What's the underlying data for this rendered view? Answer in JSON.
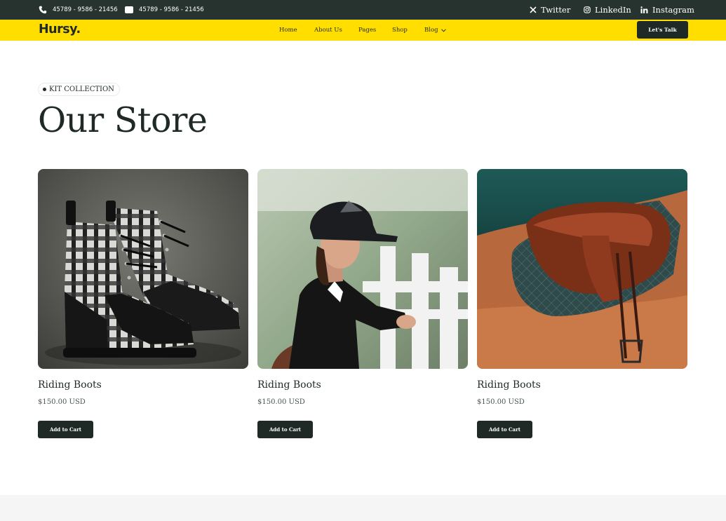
{
  "topbar": {
    "phone": "45789 - 9586 - 21456",
    "whatsapp": "45789 - 9586 - 21456",
    "social": [
      {
        "label": "Twitter",
        "icon": "x-icon"
      },
      {
        "label": "LinkedIn",
        "icon": "instagram-icon"
      },
      {
        "label": "Instagram",
        "icon": "linkedin-icon"
      }
    ]
  },
  "navbar": {
    "logo": "Hursy.",
    "links": [
      "Home",
      "About Us",
      "Pages",
      "Shop",
      "Blog"
    ],
    "cta": "Let's Talk"
  },
  "hero": {
    "badge": "KIT COLLECTION",
    "title": "Our Store"
  },
  "products": [
    {
      "name": "Riding Boots",
      "price": "$150.00 USD",
      "button": "Add to Cart"
    },
    {
      "name": "Riding Boots",
      "price": "$150.00 USD",
      "button": "Add to Cart"
    },
    {
      "name": "Riding Boots",
      "price": "$150.00 USD",
      "button": "Add to Cart"
    }
  ],
  "colors": {
    "topbar_bg": "#27332f",
    "accent": "#ffde00",
    "button_bg": "#1f2a26",
    "text": "#1f2a26"
  }
}
